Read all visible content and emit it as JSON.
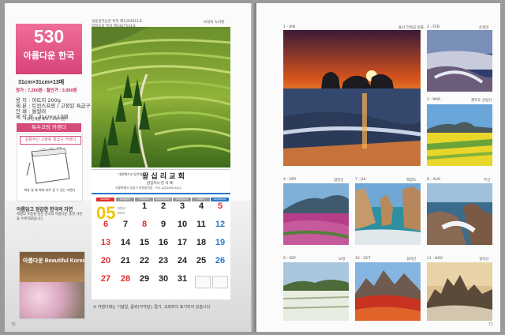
{
  "left_page": {
    "product_number": "530",
    "product_name": "아름다운 한국",
    "size": "31cm×31cm×13매",
    "price": "정가 : 7,200원 · 할인가 : 3,950원",
    "spec_lines": [
      "용  지 : 아트지 200g",
      "제  본 : 트윈스프링 / 고정된 특급구",
      "인  쇄 : 올컬러",
      "제 작 판 : 31cm×13매"
    ],
    "spec_note": "(각 단계별 제작 / 1매 기준)",
    "special_button": "특수코팅 카렌다",
    "spring_title": "실용적인 고정된 특급구 카렌다",
    "spring_desc": "벽과 걸 때 벽에 바로 걸 수 있는 카렌다",
    "feature_title": "아름답고 정감한 한국의 자연",
    "feature_desc": "계절의 흐름을 담은 한국의 아름다운 풍경 사진을 수록하였습니다.",
    "thumb_title": "아름다운 Beautiful Korea",
    "footnote_top": [
      "실용성가능한 특허 제1303611호",
      "직접도장 특허 제1327531호"
    ],
    "footnote_bottom": "※ 카렌다에는 기념일, 음력(각각달), 절기, 교회력이 표기되어 있습니다.",
    "page_number": "70",
    "photo_caption": "보성의 녹차밭",
    "calendar": {
      "church_name": "왕 십 리 교 회",
      "church_sub": "대한예수교 장로회",
      "pastor": "담임목사 김 석 백",
      "address": "서울특별시 성동구 하왕십리동 · TEL (02)2295-3413",
      "month": "05",
      "year": "2012",
      "month_name": "MAY",
      "day_headers": [
        "SUNDAY",
        "MONDAY",
        "TUESDAY",
        "WEDNESDAY",
        "THURSDAY",
        "FRIDAY",
        "SATURDAY"
      ],
      "weeks": [
        [
          "",
          "",
          "1",
          "2",
          "3",
          "4",
          "5"
        ],
        [
          "6",
          "7",
          "8",
          "9",
          "10",
          "11",
          "12"
        ],
        [
          "13",
          "14",
          "15",
          "16",
          "17",
          "18",
          "19"
        ],
        [
          "20",
          "21",
          "22",
          "23",
          "24",
          "25",
          "26"
        ],
        [
          "27",
          "28",
          "29",
          "30",
          "31",
          "",
          ""
        ]
      ]
    }
  },
  "right_page": {
    "page_number": "71",
    "tiles": [
      {
        "label": "1 - JAN",
        "place": "울산 간절곶 일출"
      },
      {
        "label": "2 - FEB",
        "place": "순천만"
      },
      {
        "label": "3 - MAR",
        "place": "제주도 산방산"
      },
      {
        "label": "4 - APR",
        "place": "합천군"
      },
      {
        "label": "7 - JUL",
        "place": "백령도"
      },
      {
        "label": "8 - AUG",
        "place": "부산"
      },
      {
        "label": "9 - SEP",
        "place": "보성"
      },
      {
        "label": "10 - OCT",
        "place": "설악산"
      },
      {
        "label": "11 - NOV",
        "place": "설악산"
      }
    ]
  },
  "colors": {
    "brand_pink": "#d8437a",
    "sunday_red": "#e0302e",
    "saturday_blue": "#2c77c9",
    "month_yellow": "#f2c40a"
  }
}
